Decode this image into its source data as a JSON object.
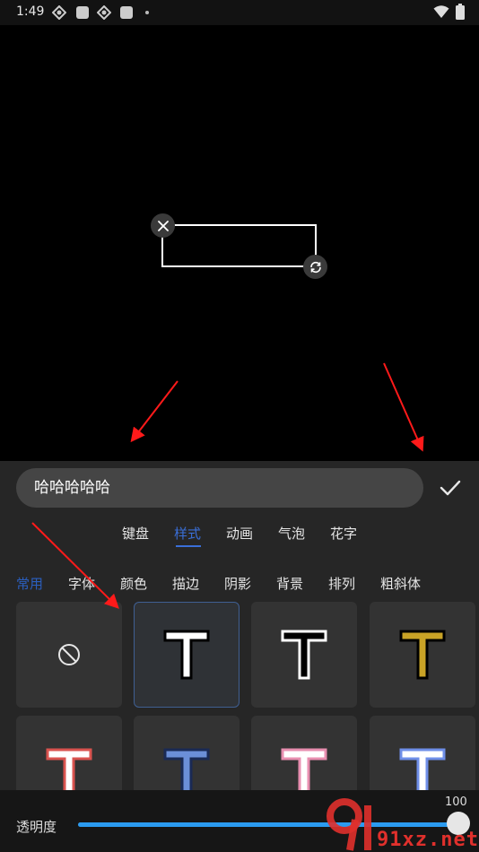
{
  "status_bar": {
    "time": "1:49"
  },
  "input": {
    "value": "哈哈哈哈哈"
  },
  "main_tabs": [
    {
      "label": "键盘"
    },
    {
      "label": "样式"
    },
    {
      "label": "动画"
    },
    {
      "label": "气泡"
    },
    {
      "label": "花字"
    }
  ],
  "active_main_tab": "样式",
  "sub_tabs": [
    {
      "label": "常用"
    },
    {
      "label": "字体"
    },
    {
      "label": "颜色"
    },
    {
      "label": "描边"
    },
    {
      "label": "阴影"
    },
    {
      "label": "背景"
    },
    {
      "label": "排列"
    },
    {
      "label": "粗斜体"
    }
  ],
  "active_sub_tab": "常用",
  "styles": [
    {
      "type": "none",
      "icon": "no-style-icon"
    },
    {
      "type": "T",
      "fill": "#ffffff",
      "stroke": "#000000",
      "selected": true
    },
    {
      "type": "T",
      "fill": "#000000",
      "stroke": "#ffffff"
    },
    {
      "type": "T",
      "fill": "#c9a326",
      "stroke": "#000000"
    },
    {
      "type": "T",
      "fill": "#ffffff",
      "stroke": "#d9534f"
    },
    {
      "type": "T",
      "fill": "#6b8fd8",
      "stroke": "#1a2a55"
    },
    {
      "type": "T",
      "fill": "#ffffff",
      "stroke": "#e88fb0"
    },
    {
      "type": "T",
      "fill": "#ffffff",
      "stroke": "#6f8fe8"
    }
  ],
  "opacity": {
    "label": "透明度",
    "value": "100",
    "level": 1.0
  },
  "watermark": {
    "text": "91xz.net"
  },
  "colors": {
    "accent": "#3a6fd8",
    "slider": "#2b9bf0",
    "panel": "#262626"
  }
}
